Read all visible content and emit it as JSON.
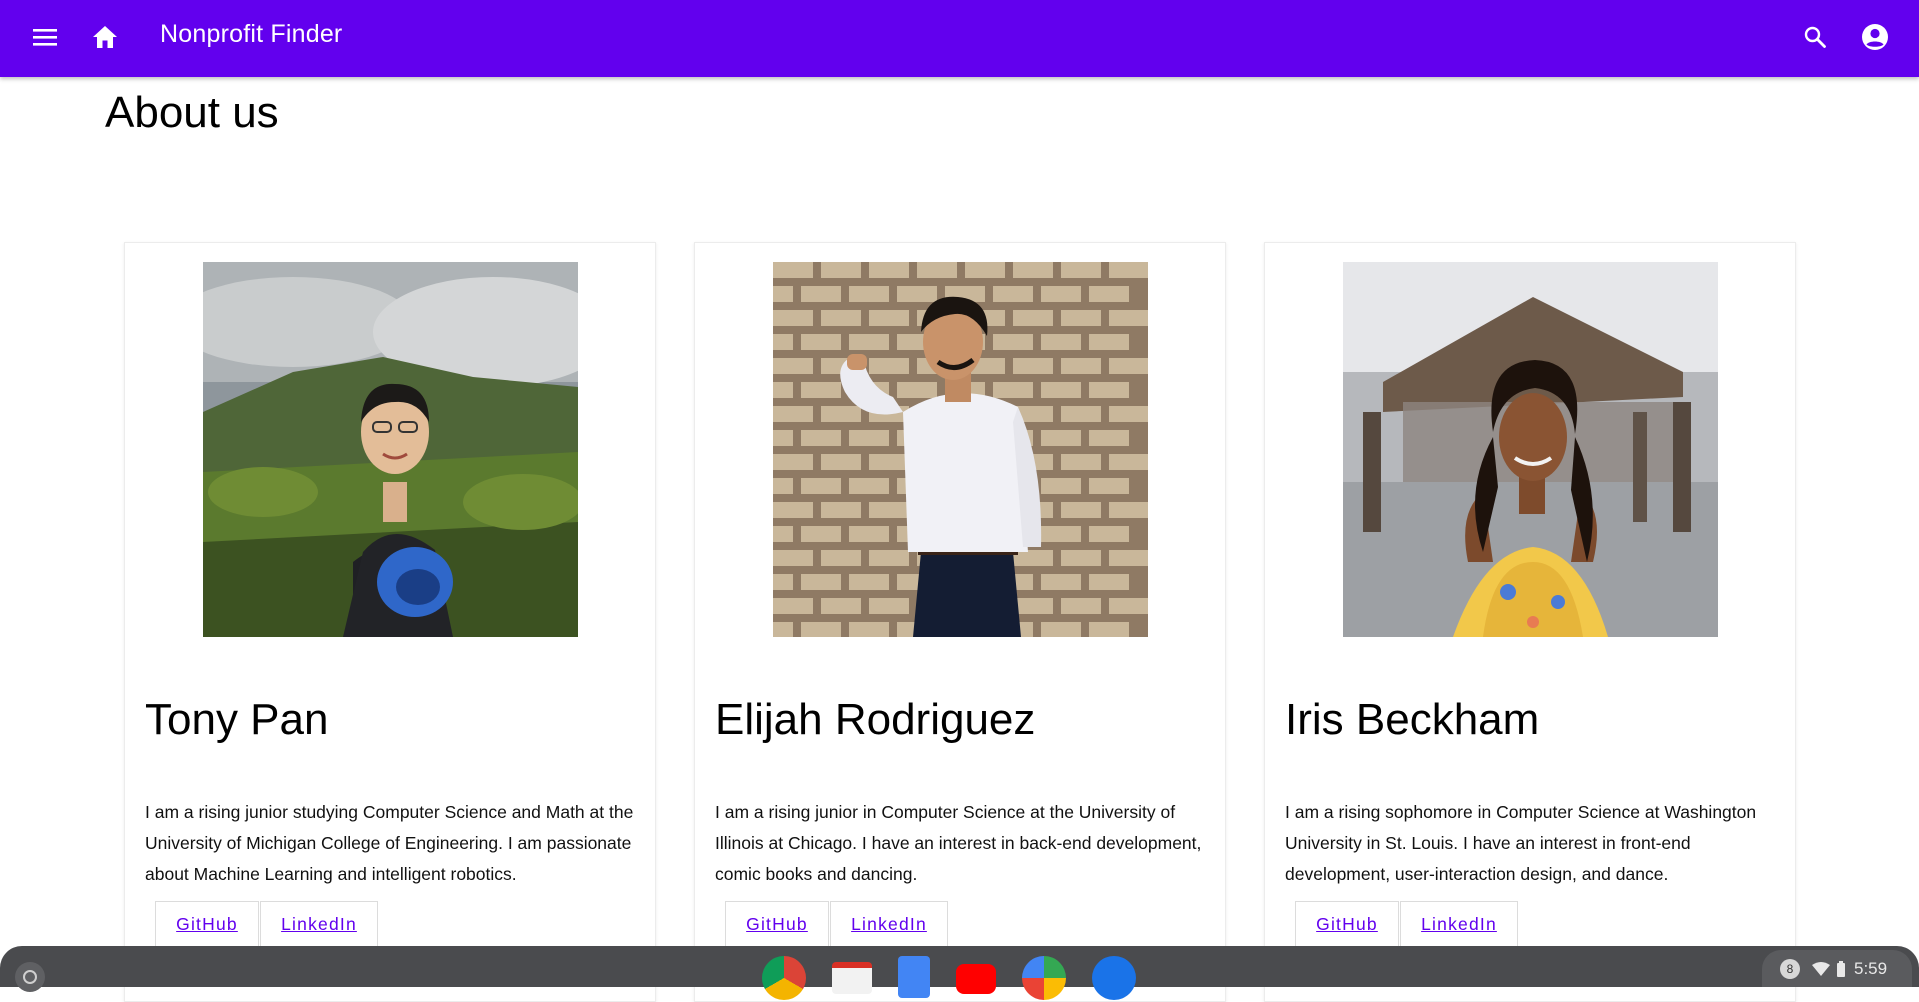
{
  "app": {
    "title": "Nonprofit Finder",
    "accent": "#6200ee"
  },
  "icons": {
    "menu": "menu-icon",
    "home": "home-icon",
    "search": "search-icon",
    "account": "account-circle-icon"
  },
  "page": {
    "title": "About us"
  },
  "members": [
    {
      "name": "Tony Pan",
      "bio": "I am a rising junior studying Computer Science and Math at the University of Michigan College of Engineering. I am passionate about Machine Learning and intelligent robotics.",
      "github_label": "GitHub",
      "linkedin_label": "LinkedIn"
    },
    {
      "name": "Elijah Rodriguez",
      "bio": "I am a rising junior in Computer Science at the University of Illinois at Chicago. I have an interest in back-end development, comic books and dancing.",
      "github_label": "GitHub",
      "linkedin_label": "LinkedIn"
    },
    {
      "name": "Iris Beckham",
      "bio": "I am a rising sophomore in Computer Science at Washington University in St. Louis. I have an interest in front-end development, user-interaction design, and dance.",
      "github_label": "GitHub",
      "linkedin_label": "LinkedIn"
    }
  ],
  "shelf": {
    "apps": [
      "chrome-icon",
      "gmail-icon",
      "docs-icon",
      "youtube-icon",
      "play-store-icon",
      "files-icon"
    ],
    "notification_count": "8",
    "time": "5:59"
  }
}
